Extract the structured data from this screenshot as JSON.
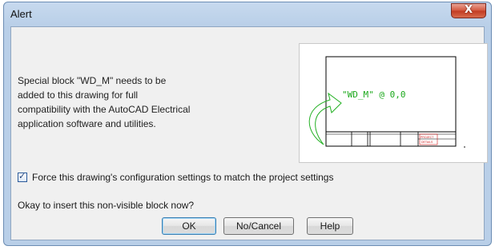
{
  "window": {
    "title": "Alert",
    "close_glyph": "X"
  },
  "message": {
    "line1": "Special block \"WD_M\" needs to be",
    "line2": "added to this drawing for full",
    "line3": "compatibility with the AutoCAD Electrical",
    "line4": "application software and utilities."
  },
  "preview": {
    "label": "\"WD_M\" @ 0,0",
    "title_block_text_1": "PROJECT",
    "title_block_text_2": "DETAILS",
    "colors": {
      "frame": "#000000",
      "label": "#1aa81a",
      "arrow": "#22b022",
      "title_block": "#d01818"
    },
    "icons": [
      "curved-arrow-icon"
    ]
  },
  "checkbox": {
    "checked": true,
    "label": "Force this drawing's configuration settings to match the project settings"
  },
  "question": "Okay to insert this non-visible block now?",
  "buttons": {
    "ok": "OK",
    "cancel": "No/Cancel",
    "help": "Help"
  }
}
